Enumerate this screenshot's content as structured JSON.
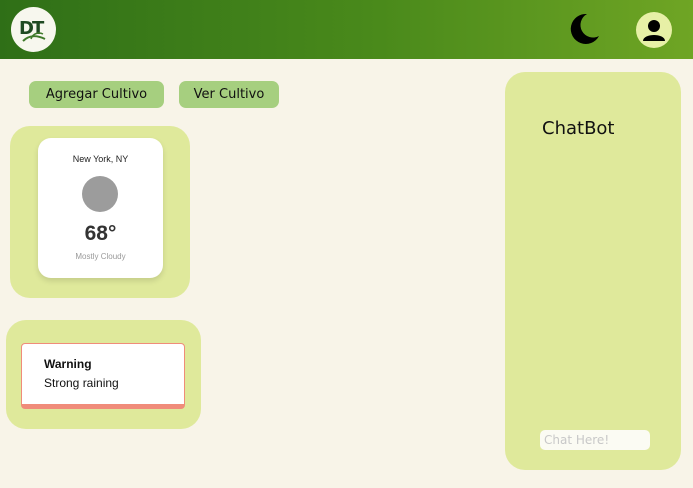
{
  "header": {
    "logo_text": "DT",
    "theme_toggle_icon": "moon-icon",
    "profile_icon": "user-icon"
  },
  "actions": {
    "add_crop_label": "Agregar Cultivo",
    "view_crop_label": "Ver Cultivo"
  },
  "weather": {
    "city": "New York, NY",
    "temperature": "68°",
    "condition": "Mostly Cloudy",
    "icon": "weather-circle-icon"
  },
  "warning": {
    "title": "Warning",
    "message": "Strong raining"
  },
  "chat": {
    "title": "ChatBot",
    "input_placeholder": "Chat Here!"
  },
  "colors": {
    "header_start": "#2f6f17",
    "header_end": "#6fa524",
    "panel": "#dfe99b",
    "button": "#a6cf7f",
    "background": "#f8f4e8",
    "warning_accent": "#f08c7a"
  }
}
